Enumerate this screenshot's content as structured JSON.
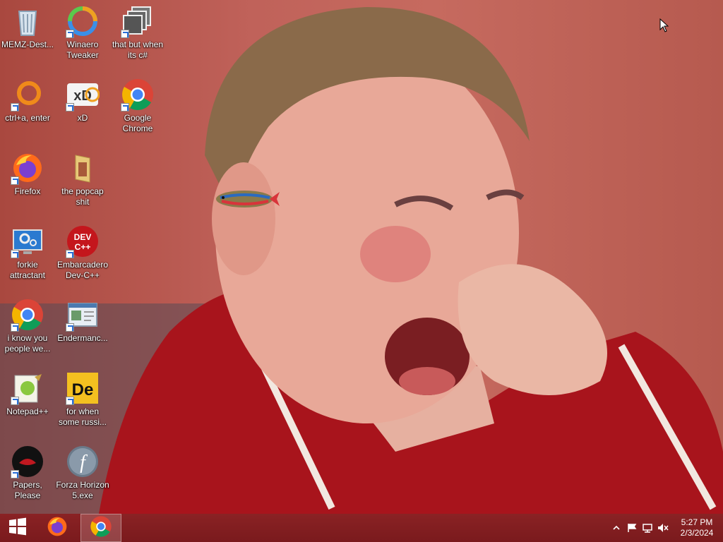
{
  "desktop": {
    "icons": [
      {
        "label": "MEMZ-Dest...",
        "icon": "recycle-bin-icon"
      },
      {
        "label": "Winaero Tweaker",
        "icon": "winaero-tweaker-icon"
      },
      {
        "label": "that but when its c#",
        "icon": "stacked-windows-icon"
      },
      {
        "label": "ctrl+a, enter",
        "icon": "orange-ring-icon"
      },
      {
        "label": "xD",
        "icon": "hxd-icon"
      },
      {
        "label": "Google Chrome",
        "icon": "chrome-icon"
      },
      {
        "label": "Firefox",
        "icon": "firefox-icon"
      },
      {
        "label": "the popcap shit",
        "icon": "folder-icon"
      },
      {
        "label": "forkie attractant",
        "icon": "monitor-gear-icon"
      },
      {
        "label": "Embarcadero Dev-C++",
        "icon": "devcpp-icon"
      },
      {
        "label": "i know you people we...",
        "icon": "chrome-icon"
      },
      {
        "label": "Endermanc...",
        "icon": "window-document-icon"
      },
      {
        "label": "Notepad++",
        "icon": "notepadpp-icon"
      },
      {
        "label": "for when some russi...",
        "icon": "de-icon"
      },
      {
        "label": "Papers, Please",
        "icon": "papers-please-icon"
      },
      {
        "label": "Forza Horizon 5.exe",
        "icon": "flash-icon"
      }
    ]
  },
  "taskbar": {
    "start_icon": "windows-logo-icon",
    "pinned": [
      {
        "name": "firefox",
        "icon": "firefox-icon",
        "active": false
      },
      {
        "name": "chrome",
        "icon": "chrome-icon",
        "active": true
      }
    ],
    "tray": {
      "icons": [
        "chevron-up-icon",
        "flag-icon",
        "network-icon",
        "volume-muted-icon"
      ],
      "time": "5:27 PM",
      "date": "2/3/2024"
    }
  },
  "colors": {
    "taskbar": "#7a1a1d",
    "wallpaper_bg": "#c0625a"
  }
}
